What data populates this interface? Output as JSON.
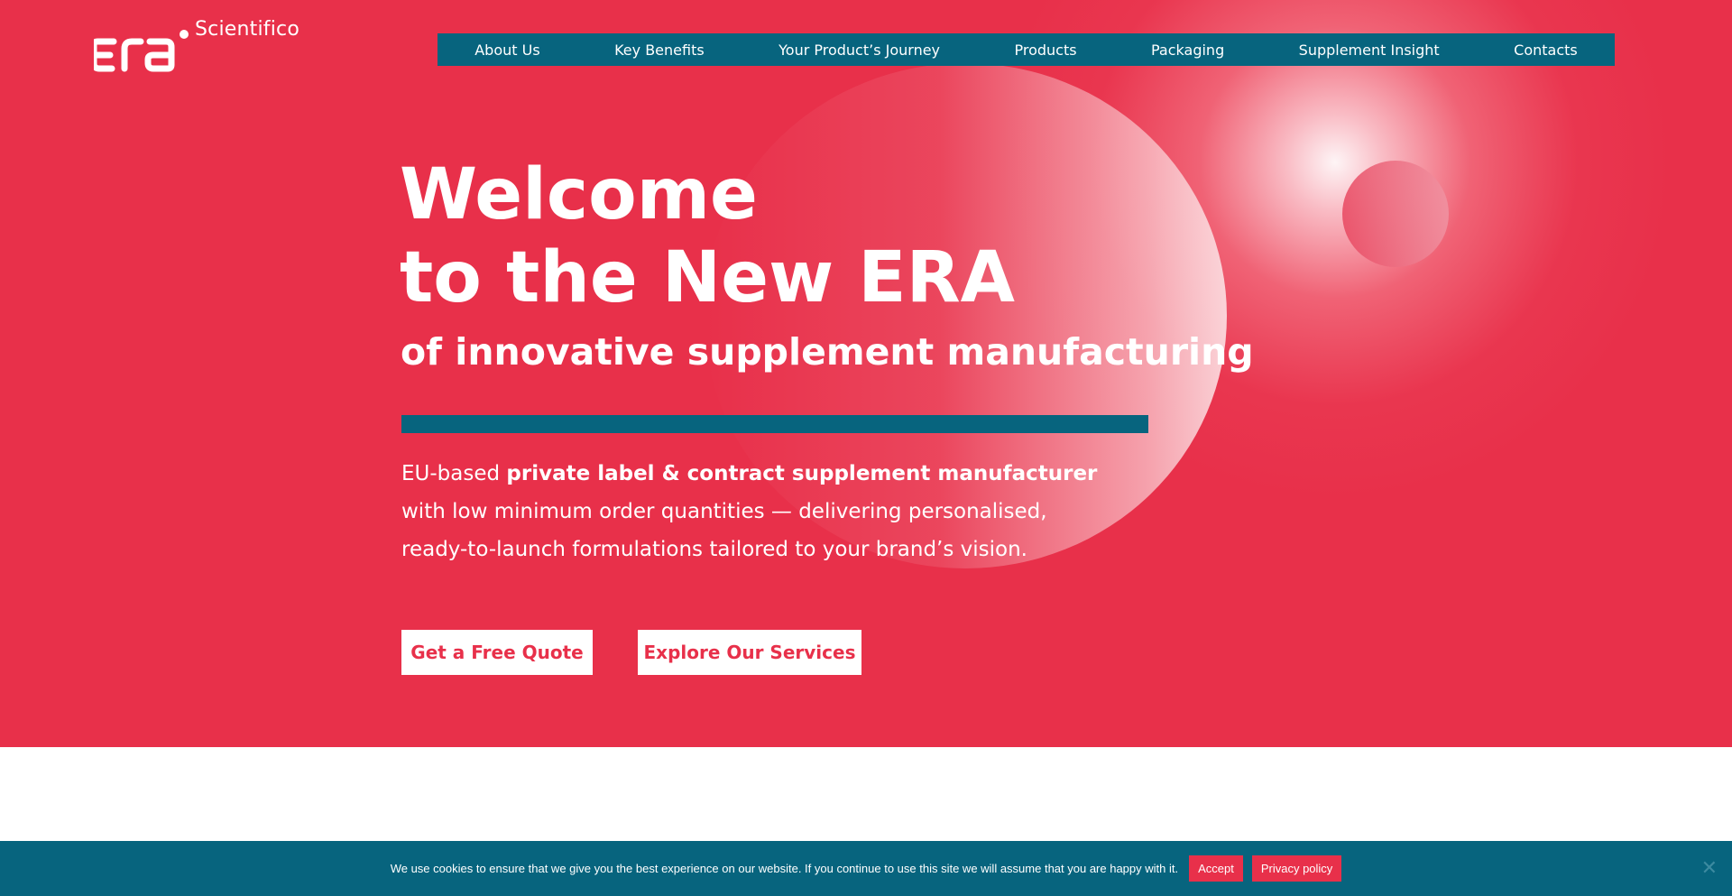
{
  "brand": {
    "logo_text": "Scientifico",
    "logo_icon": "era-logo-icon",
    "primary_color": "#e8304a",
    "secondary_color": "#07647e"
  },
  "nav": {
    "items": [
      {
        "label": "About Us"
      },
      {
        "label": "Key Benefits"
      },
      {
        "label": "Your Product’s Journey"
      },
      {
        "label": "Products"
      },
      {
        "label": "Packaging"
      },
      {
        "label": "Supplement Insight"
      },
      {
        "label": "Contacts"
      }
    ]
  },
  "hero": {
    "headline_line1": "Welcome",
    "headline_line2": "to the New ERA",
    "subheadline": "of innovative supplement manufacturing",
    "description_prefix": "EU-based ",
    "description_bold": "private label & contract supplement manufacturer",
    "description_line2": "with low minimum order quantities — delivering personalised,",
    "description_line3": "ready-to-launch formulations tailored to your brand’s vision.",
    "cta_primary": "Get a Free Quote",
    "cta_secondary": "Explore Our Services"
  },
  "cookie": {
    "message": "We use cookies to ensure that we give you the best experience on our website. If you continue to use this site we will assume that you are happy with it.",
    "accept_label": "Accept",
    "privacy_label": "Privacy policy",
    "close_icon": "close-icon",
    "close_symbol": "✕"
  }
}
